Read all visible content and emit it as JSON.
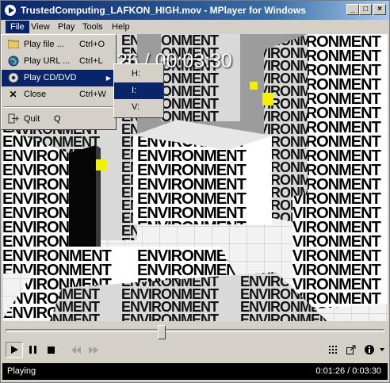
{
  "window": {
    "title": "TrustedComputing_LAFKON_HIGH.mov - MPlayer for Windows",
    "minimize_glyph": "_",
    "maximize_glyph": "□",
    "close_glyph": "×"
  },
  "menubar": {
    "items": [
      {
        "label": "File"
      },
      {
        "label": "View"
      },
      {
        "label": "Play"
      },
      {
        "label": "Tools"
      },
      {
        "label": "Help"
      }
    ]
  },
  "file_menu": {
    "items": [
      {
        "label": "Play file ...",
        "shortcut": "Ctrl+O",
        "icon": "folder-icon"
      },
      {
        "label": "Play URL ...",
        "shortcut": "Ctrl+L",
        "icon": "globe-icon"
      },
      {
        "label": "Play CD/DVD",
        "shortcut": "",
        "icon": "disc-icon",
        "has_submenu": true
      },
      {
        "label": "Close",
        "shortcut": "Ctrl+W",
        "icon": "close-icon"
      },
      {
        "label": "Quit",
        "shortcut": "Q",
        "icon": "exit-icon"
      }
    ]
  },
  "cd_submenu": {
    "items": [
      {
        "label": "H:"
      },
      {
        "label": "I:"
      },
      {
        "label": "V:"
      }
    ]
  },
  "video": {
    "osd_time": "26 / 00:03:30",
    "scene_word": "ENVIRONMENT"
  },
  "seek": {
    "position_fraction": 0.41
  },
  "controls": {
    "play": "play-icon",
    "pause": "pause-icon",
    "stop": "stop-icon",
    "previous": "previous-icon",
    "next": "next-icon",
    "playlist": "playlist-icon",
    "fullscreen": "fullscreen-icon",
    "info": "info-icon",
    "dropdown": "chevron-down-icon"
  },
  "status": {
    "state": "Playing",
    "time": "0:01:26 / 0:03:30"
  },
  "colors": {
    "selection": "#0a246a",
    "title_gradient_start": "#0a246a",
    "title_gradient_end": "#a6caf0",
    "chrome": "#d4d0c8",
    "status_bg": "#000000"
  }
}
